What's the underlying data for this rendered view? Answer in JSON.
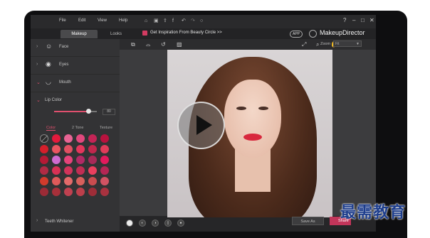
{
  "menu": {
    "file": "File",
    "edit": "Edit",
    "view": "View",
    "help": "Help"
  },
  "title_icons": [
    "home-icon",
    "save-icon",
    "share-icon",
    "facebook-icon",
    "undo-icon",
    "redo-icon",
    "reset-icon"
  ],
  "window_buttons": {
    "help": "?",
    "minimize": "–",
    "maximize": "□",
    "close": "✕"
  },
  "tabs": [
    {
      "label": "Makeup",
      "active": true
    },
    {
      "label": "Looks",
      "active": false
    }
  ],
  "inspiration": "Get Inspiration From Beauty Circle >>",
  "app_badge": "APP",
  "brand": "MakeupDirector",
  "left_panel": {
    "categories": [
      {
        "label": "Face",
        "icon": "face-icon",
        "open": false
      },
      {
        "label": "Eyes",
        "icon": "eye-icon",
        "open": false
      },
      {
        "label": "Mouth",
        "icon": "lips-icon",
        "open": true
      }
    ],
    "section": "Lip Color",
    "slider": {
      "value": "80",
      "fraction": 0.8
    },
    "subtabs": [
      "Color",
      "2 Tone",
      "Texture"
    ],
    "active_subtab": "Color",
    "swatches": [
      [
        "none",
        "#e21a3c",
        "#e86494",
        "#e2487d",
        "#c42456",
        "#b8123e"
      ],
      [
        "#d51f2b",
        "#ea5561",
        "#e04f62",
        "#e4365c",
        "#c1274d",
        "#e03c5a"
      ],
      [
        "#b51a35",
        "#cf6bd0",
        "#e6437a",
        "#b22a65",
        "#a72a58",
        "#e21a5c"
      ],
      [
        "#b02b44",
        "#d83155",
        "#d1335a",
        "#c12d53",
        "#ea3f5e",
        "#b42654"
      ],
      [
        "#d23b2c",
        "#df5a5a",
        "#e46a6a",
        "#d8605c",
        "#c94c4f",
        "#d15363"
      ],
      [
        "#9c2b36",
        "#a7303a",
        "#c04150",
        "#bd3f4b",
        "#9e2d38",
        "#a8323f"
      ]
    ],
    "bottom_item": "Teeth Whitener"
  },
  "toolbar": {
    "left_tools": [
      "compare-icon",
      "mask-icon",
      "history-icon",
      "crop-icon"
    ],
    "right_tools": [
      "fit-icon",
      "zoom-icon",
      "hand-icon"
    ],
    "zoom_label": "Zoom",
    "zoom_value": "Fit"
  },
  "bottom_bar": {
    "mode_buttons": [
      "single-view-icon",
      "dual-view-icon",
      "split-view-icon",
      "side-by-side-icon",
      "reset-face-icon"
    ],
    "save_as": "Save As",
    "share": "Share"
  },
  "watermark": "最需教育"
}
